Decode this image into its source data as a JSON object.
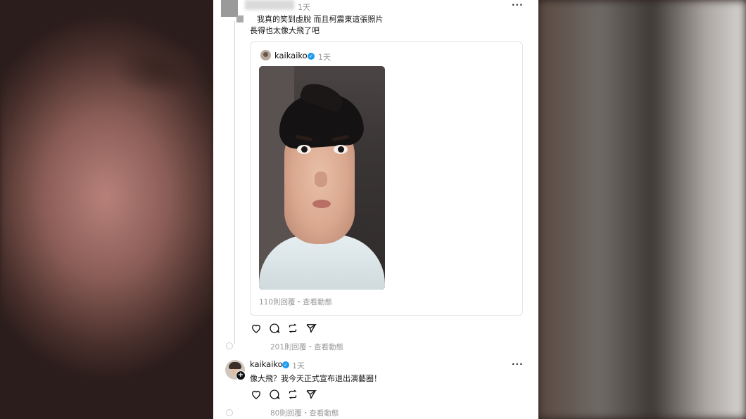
{
  "top_comment": {
    "time": "1天",
    "more": "···",
    "text_line1": "我真的笑到虛脫 而且柯震東這張照片",
    "text_line2": "長得也太像大飛了吧",
    "quote": {
      "username": "kaikaiko",
      "verified_mark": "✓",
      "time": "1天",
      "stats": "110則回覆・查看動態"
    },
    "stats": "201則回覆・查看動態"
  },
  "reply": {
    "username": "kaikaiko",
    "verified_mark": "✓",
    "time": "1天",
    "more": "···",
    "plus": "+",
    "text": "像大飛？我今天正式宣布退出演藝圈！",
    "stats": "80則回覆・查看動態"
  },
  "icons": [
    "heart-icon",
    "comment-icon",
    "repost-icon",
    "share-icon"
  ]
}
